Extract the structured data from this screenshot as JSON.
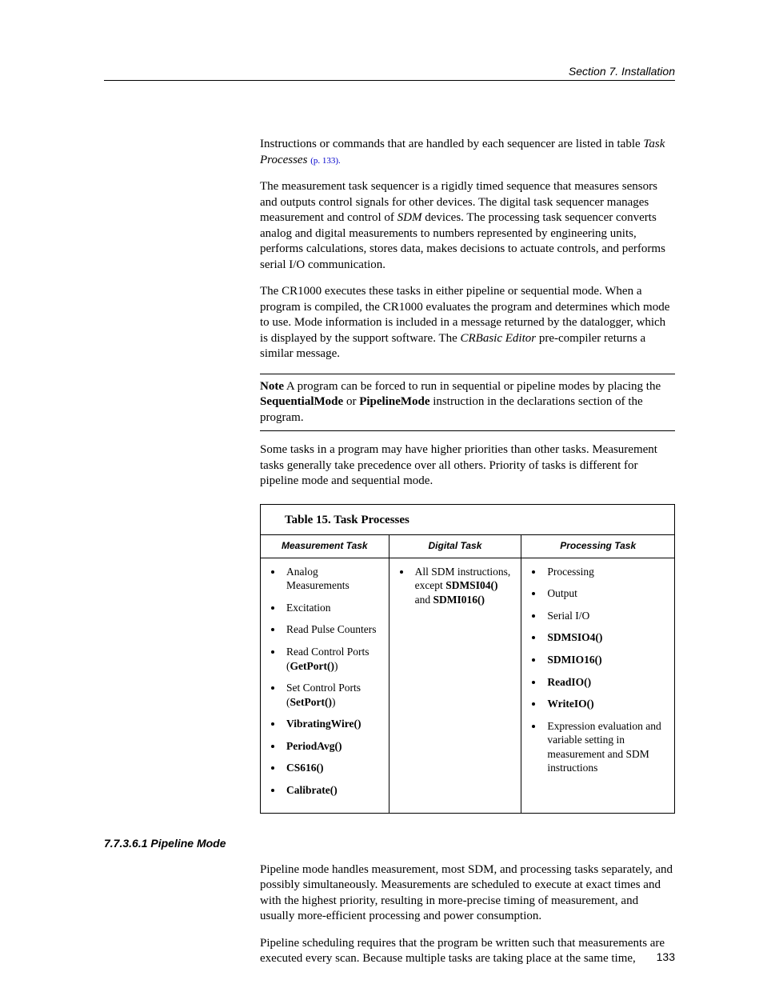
{
  "header": {
    "running": "Section 7.  Installation"
  },
  "para1": {
    "a": "Instructions or commands that are handled by each sequencer are listed in table ",
    "b_italic": "Task Processes ",
    "c_ref": "(p. 133)."
  },
  "para2": {
    "a": "The measurement task sequencer is a rigidly timed sequence that measures sensors and outputs control signals for other devices.  The digital task sequencer manages measurement and control of ",
    "b_italic": "SDM",
    "c": " devices.  The processing task sequencer converts analog and digital measurements to numbers represented by engineering units, performs calculations, stores data, makes decisions to actuate controls, and performs serial I/O communication."
  },
  "para3": {
    "a": "The CR1000 executes these tasks in either pipeline or sequential mode. When a program is compiled, the CR1000 evaluates the program and determines which mode to use.  Mode information is included in a message returned by the datalogger, which is displayed by the support software. The ",
    "b_italic": "CRBasic Editor",
    "c": " pre-compiler returns a similar message."
  },
  "note": {
    "label": "Note",
    "a": "  A program can be forced to run in sequential or pipeline modes by placing the ",
    "b_bold": "SequentialMode",
    "c": " or ",
    "d_bold": "PipelineMode",
    "e": " instruction in the declarations section of the program."
  },
  "para4": "Some tasks in a program may have higher priorities than other tasks.  Measurement tasks generally take precedence over all others.  Priority of tasks is different for pipeline mode and sequential mode.",
  "table": {
    "title": "Table 15. Task Processes",
    "columns": {
      "measurement": "Measurement Task",
      "digital": "Digital Task",
      "processing": "Processing Task"
    }
  },
  "measurement_items": {
    "i0": {
      "a": "Analog Measurements"
    },
    "i1": {
      "a": "Excitation"
    },
    "i2": {
      "a": "Read Pulse Counters"
    },
    "i3": {
      "a": "Read Control Ports (",
      "b_bold": "GetPort()",
      "c": ")"
    },
    "i4": {
      "a": "Set Control Ports (",
      "b_bold": "SetPort()",
      "c": ")"
    },
    "i5": {
      "b_bold": "VibratingWire()"
    },
    "i6": {
      "b_bold": "PeriodAvg()"
    },
    "i7": {
      "b_bold": "CS616()"
    },
    "i8": {
      "b_bold": "Calibrate()"
    }
  },
  "digital_items": {
    "i0": {
      "a": "All SDM instructions, except ",
      "b_bold": "SDMSI04()",
      "c": " and ",
      "d_bold": "SDMI016()"
    }
  },
  "processing_items": {
    "i0": {
      "a": "Processing"
    },
    "i1": {
      "a": "Output"
    },
    "i2": {
      "a": "Serial I/O"
    },
    "i3": {
      "b_bold": "SDMSIO4()"
    },
    "i4": {
      "b_bold": "SDMIO16()"
    },
    "i5": {
      "b_bold": "ReadIO()"
    },
    "i6": {
      "b_bold": "WriteIO()"
    },
    "i7": {
      "a": "Expression evaluation and variable setting in measurement and SDM instructions"
    }
  },
  "section_heading": "7.7.3.6.1 Pipeline Mode",
  "para5": "Pipeline mode handles measurement, most SDM, and processing tasks separately, and possibly simultaneously. Measurements are scheduled to execute at exact times and with the highest priority, resulting in more-precise timing of measurement, and usually more-efficient processing and power consumption.",
  "para6": "Pipeline scheduling requires that the program be written such that measurements are executed every scan. Because multiple tasks are taking place at the same time,",
  "page_number": "133"
}
